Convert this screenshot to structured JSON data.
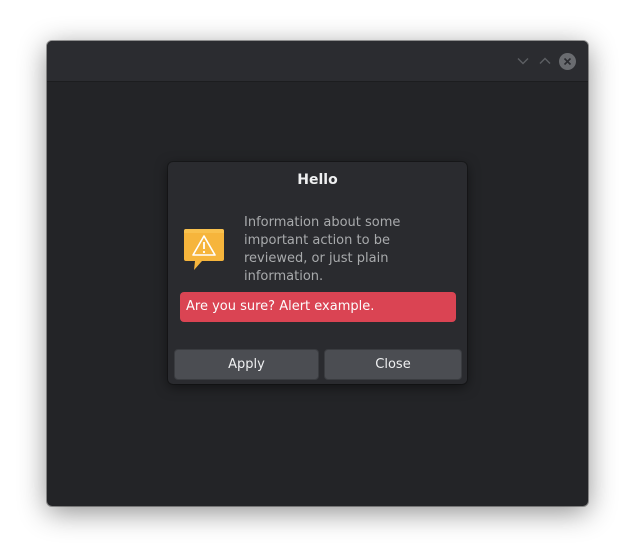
{
  "window": {
    "titlebar": {
      "buttons": [
        {
          "name": "minimize",
          "icon": "chevron-down-icon"
        },
        {
          "name": "maximize",
          "icon": "chevron-up-icon"
        },
        {
          "name": "close",
          "icon": "close-icon"
        }
      ]
    },
    "background_color": "#232427"
  },
  "dialog": {
    "title": "Hello",
    "icon": "warning-icon",
    "message": "Information about some important action to be reviewed, or just plain information.",
    "alert": {
      "text": "Are you sure? Alert example.",
      "color": "#da4453"
    },
    "buttons": {
      "apply_label": "Apply",
      "close_label": "Close"
    }
  },
  "colors": {
    "warning_icon": "#f6b53c",
    "button_bg": "#4b4d52"
  }
}
